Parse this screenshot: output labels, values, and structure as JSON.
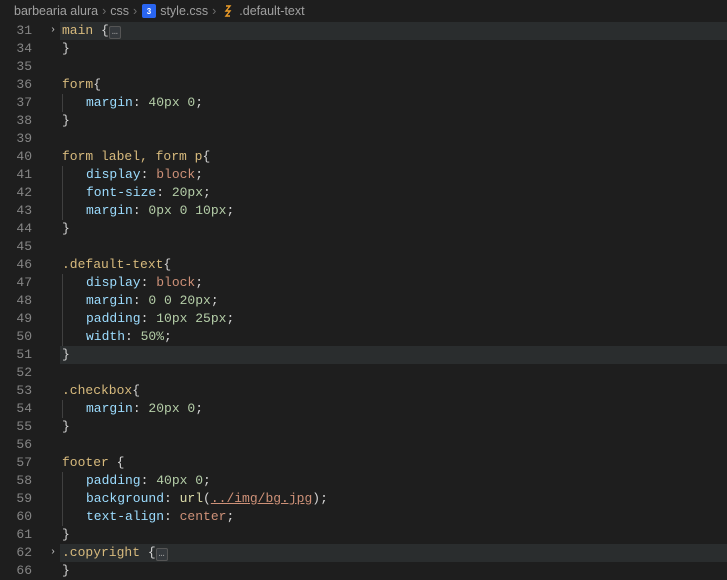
{
  "breadcrumb": {
    "folder": "barbearia alura",
    "subfolder": "css",
    "file": "style.css",
    "symbol": ".default-text"
  },
  "lines": {
    "l31a": "main",
    "l31b": "{",
    "l34": "}",
    "l36a": "form",
    "l36b": "{",
    "l37p": "margin",
    "l37v": "40px 0",
    "l38": "}",
    "l40a": "form label, form p",
    "l40b": "{",
    "l41p": "display",
    "l41v": "block",
    "l42p": "font-size",
    "l42v": "20px",
    "l43p": "margin",
    "l43v": "0px 0 10px",
    "l44": "}",
    "l46a": ".default-text",
    "l46b": "{",
    "l47p": "display",
    "l47v": "block",
    "l48p": "margin",
    "l48v": "0 0 20px",
    "l49p": "padding",
    "l49v": "10px 25px",
    "l50p": "width",
    "l50v": "50%",
    "l51": "}",
    "l53a": ".checkbox",
    "l53b": "{",
    "l54p": "margin",
    "l54v": "20px 0",
    "l55": "}",
    "l57a": "footer",
    "l57b": "{",
    "l58p": "padding",
    "l58v": "40px 0",
    "l59p": "background",
    "l59f": "url",
    "l59u": "../img/bg.jpg",
    "l60p": "text-align",
    "l60v": "center",
    "l61": "}",
    "l62a": ".copyright",
    "l62b": "{",
    "l66": "}"
  },
  "nums": [
    "31",
    "34",
    "35",
    "36",
    "37",
    "38",
    "39",
    "40",
    "41",
    "42",
    "43",
    "44",
    "45",
    "46",
    "47",
    "48",
    "49",
    "50",
    "51",
    "52",
    "53",
    "54",
    "55",
    "56",
    "57",
    "58",
    "59",
    "60",
    "61",
    "62",
    "66"
  ]
}
